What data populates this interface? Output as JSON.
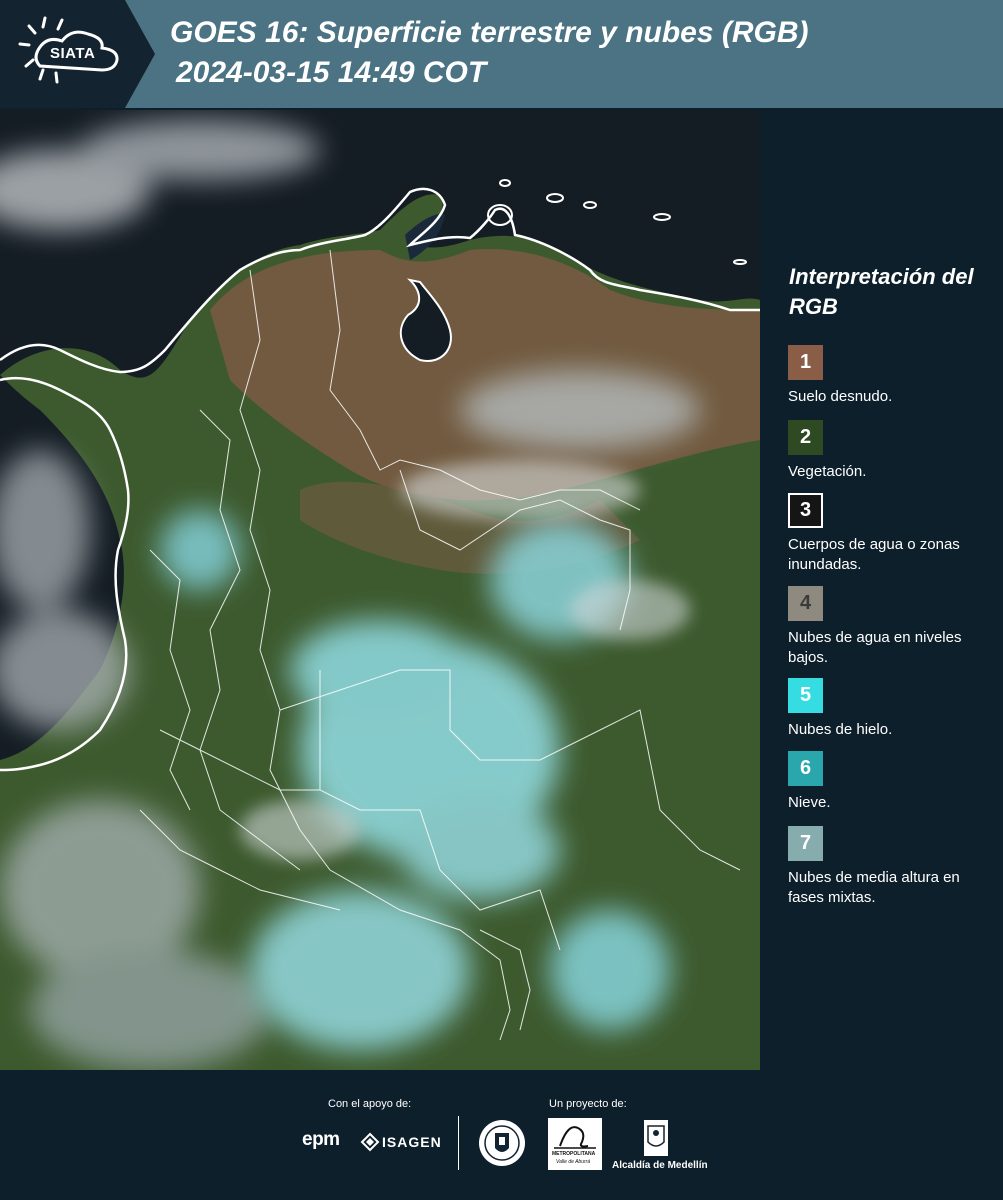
{
  "header": {
    "logo_text": "SIATA",
    "title_line1": "GOES 16: Superficie terrestre y nubes (RGB)",
    "title_line2": "2024-03-15 14:49 COT"
  },
  "legend": {
    "title": "Interpretación del RGB",
    "items": [
      {
        "num": "1",
        "label": "Suelo desnudo.",
        "color": "#8a5d46"
      },
      {
        "num": "2",
        "label": "Vegetación.",
        "color": "#2e4a22"
      },
      {
        "num": "3",
        "label": "Cuerpos de agua o zonas inundadas.",
        "color": "#151515"
      },
      {
        "num": "4",
        "label": "Nubes de agua en niveles bajos.",
        "color": "#8e8a80"
      },
      {
        "num": "5",
        "label": "Nubes de hielo.",
        "color": "#35dde2"
      },
      {
        "num": "6",
        "label": "Nieve.",
        "color": "#2aa6ad"
      },
      {
        "num": "7",
        "label": "Nubes de media altura en fases mixtas.",
        "color": "#86acae"
      }
    ]
  },
  "footer": {
    "support_caption": "Con el apoyo de:",
    "project_caption": "Un proyecto de:",
    "epm": "epm",
    "isagen": "ISAGEN",
    "area_line1": "METROPOLITANA",
    "area_line2": "Valle de Aburrá",
    "alcaldia": "Alcaldía de Medellín"
  },
  "colors": {
    "header_bg": "#4b7383",
    "logo_bg": "#13232f",
    "page_bg": "#0d1f2b"
  }
}
